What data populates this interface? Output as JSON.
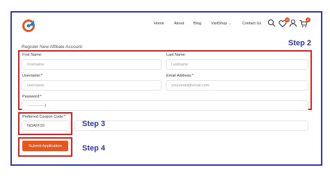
{
  "header": {
    "nav": [
      "Home",
      "About",
      "Blog",
      "VisitShop",
      "Contact Us"
    ],
    "wishlist_count": "0",
    "cart_count": "0"
  },
  "form": {
    "title": "Register New Affiliate Account:",
    "first_name": {
      "label": "First Name:",
      "placeholder": "Firstname"
    },
    "last_name": {
      "label": "Last Name:",
      "placeholder": "Lastname"
    },
    "username": {
      "label": "Username:*",
      "placeholder": "username"
    },
    "email": {
      "label": "Email Address:*",
      "placeholder": "youremail@email.com"
    },
    "password": {
      "label": "Password:*",
      "value": "··············|"
    },
    "coupon": {
      "label": "Preferred Coupon Code:*",
      "value": "NOAFF20"
    },
    "submit_label": "Submit Application"
  },
  "annotations": {
    "step2": "Step 2",
    "step3": "Step 3",
    "step4": "Step 4"
  },
  "colors": {
    "frame": "#2f3a9e",
    "highlight": "#e41c1c",
    "accent": "#e8561f"
  }
}
